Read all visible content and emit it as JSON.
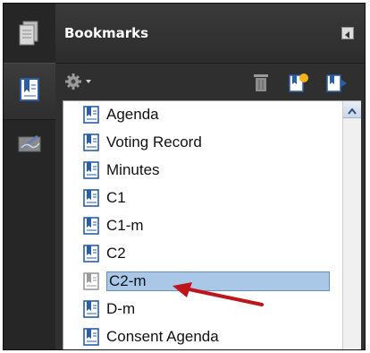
{
  "panel": {
    "title": "Bookmarks"
  },
  "icons": {
    "pages": "pages-icon",
    "bookmarks": "bookmark-panel-icon",
    "signatures": "signature-icon",
    "options": "gear-icon",
    "delete": "trash-icon",
    "new_bookmark": "new-bookmark-icon",
    "expand": "expand-bookmark-icon",
    "collapse": "collapse-panel-icon",
    "scroll_up": "scroll-up-arrow-icon"
  },
  "bookmarks": [
    {
      "label": "Agenda"
    },
    {
      "label": "Voting Record"
    },
    {
      "label": "Minutes"
    },
    {
      "label": "C1"
    },
    {
      "label": "C1-m"
    },
    {
      "label": "C2"
    },
    {
      "label": "C2-m",
      "selected": true
    },
    {
      "label": "D-m"
    },
    {
      "label": "Consent Agenda"
    }
  ],
  "colors": {
    "selection": "#a9c8e8",
    "annotation_arrow": "#c0141b",
    "bookmark_icon": "#2a5fa8"
  }
}
